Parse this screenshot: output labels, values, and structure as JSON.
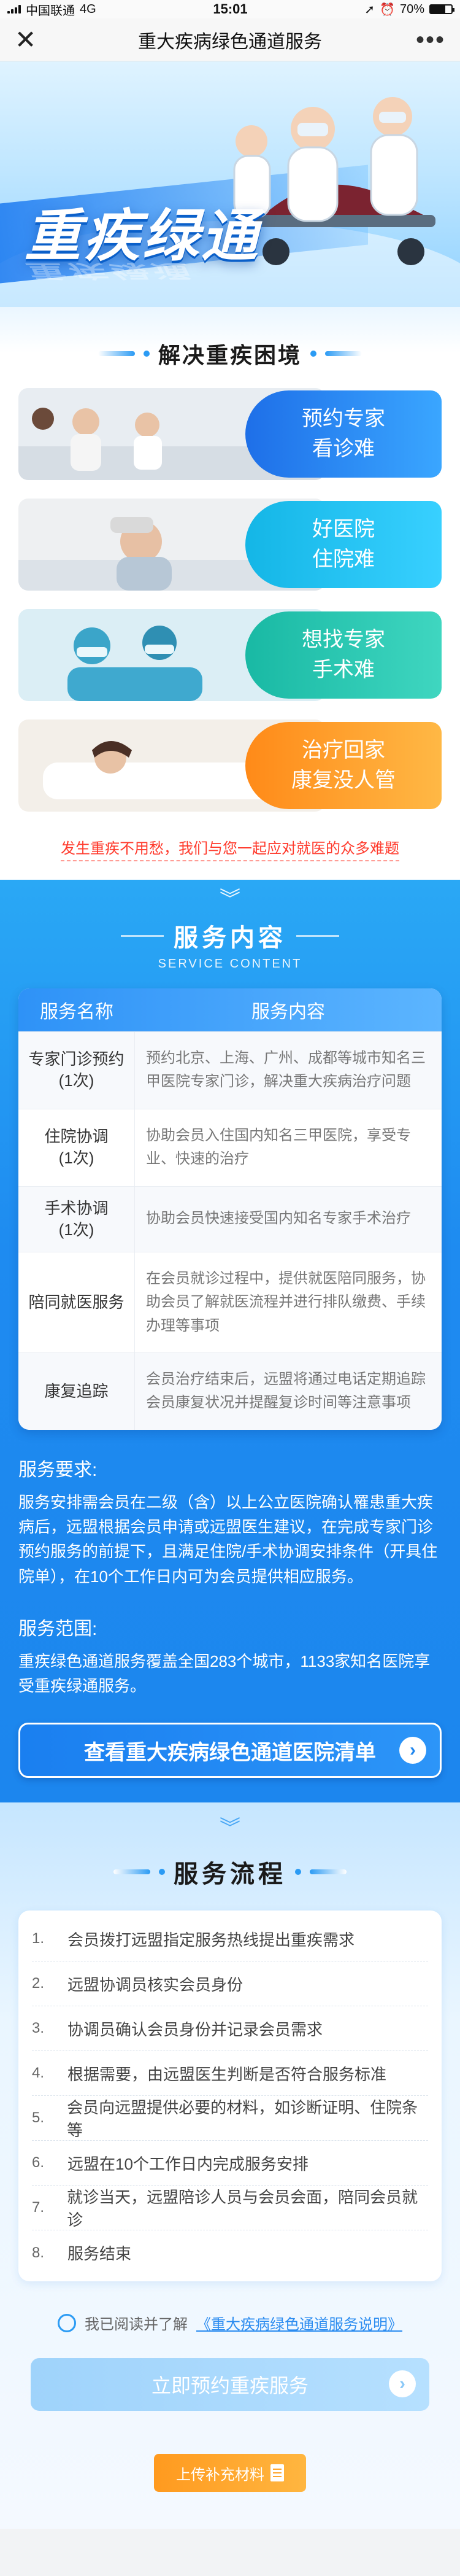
{
  "status": {
    "carrier": "中国联通",
    "network": "4G",
    "time": "15:01",
    "battery": "70%",
    "battery_level": 0.7
  },
  "nav": {
    "title": "重大疾病绿色通道服务"
  },
  "hero": {
    "brand": "重疾绿通"
  },
  "problems": {
    "title": "解决重疾困境",
    "items": [
      {
        "line1": "预约专家",
        "line2": "看诊难",
        "color": "blue"
      },
      {
        "line1": "好医院",
        "line2": "住院难",
        "color": "teal"
      },
      {
        "line1": "想找专家",
        "line2": "手术难",
        "color": "green"
      },
      {
        "line1": "治疗回家",
        "line2": "康复没人管",
        "color": "orange"
      }
    ],
    "slogan": "发生重疾不用愁，我们与您一起应对就医的众多难题"
  },
  "services": {
    "title": "服务内容",
    "subtitle": "SERVICE CONTENT",
    "col_name": "服务名称",
    "col_content": "服务内容",
    "rows": [
      {
        "name": "专家门诊预约\n(1次)",
        "content": "预约北京、上海、广州、成都等城市知名三甲医院专家门诊，解决重大疾病治疗问题"
      },
      {
        "name": "住院协调\n(1次)",
        "content": "协助会员入住国内知名三甲医院，享受专业、快速的治疗"
      },
      {
        "name": "手术协调\n(1次)",
        "content": "协助会员快速接受国内知名专家手术治疗"
      },
      {
        "name": "陪同就医服务",
        "content": "在会员就诊过程中，提供就医陪同服务，协助会员了解就医流程并进行排队缴费、手续办理等事项"
      },
      {
        "name": "康复追踪",
        "content": "会员治疗结束后，远盟将通过电话定期追踪会员康复状况并提醒复诊时间等注意事项"
      }
    ],
    "req_title": "服务要求:",
    "req_text": "服务安排需会员在二级（含）以上公立医院确认罹患重大疾病后，远盟根据会员申请或远盟医生建议，在完成专家门诊预约服务的前提下，且满足住院/手术协调安排条件（开具住院单），在10个工作日内可为会员提供相应服务。",
    "range_title": "服务范围:",
    "range_text": "重疾绿色通道服务覆盖全国283个城市，1133家知名医院享受重疾绿通服务。",
    "list_button": "查看重大疾病绿色通道医院清单"
  },
  "process": {
    "title": "服务流程",
    "steps": [
      {
        "num": "1.",
        "text": "会员拨打远盟指定服务热线提出重疾需求"
      },
      {
        "num": "2.",
        "text": "远盟协调员核实会员身份"
      },
      {
        "num": "3.",
        "text": "协调员确认会员身份并记录会员需求"
      },
      {
        "num": "4.",
        "text": "根据需要，由远盟医生判断是否符合服务标准"
      },
      {
        "num": "5.",
        "text": "会员向远盟提供必要的材料，如诊断证明、住院条等"
      },
      {
        "num": "6.",
        "text": "远盟在10个工作日内完成服务安排"
      },
      {
        "num": "7.",
        "text": "就诊当天，远盟陪诊人员与会员会面，陪同会员就诊"
      },
      {
        "num": "8.",
        "text": "服务结束"
      }
    ],
    "agree_prefix": "我已阅读并了解",
    "agree_link": "《重大疾病绿色通道服务说明》",
    "book_button": "立即预约重疾服务",
    "upload_button": "上传补充材料"
  }
}
